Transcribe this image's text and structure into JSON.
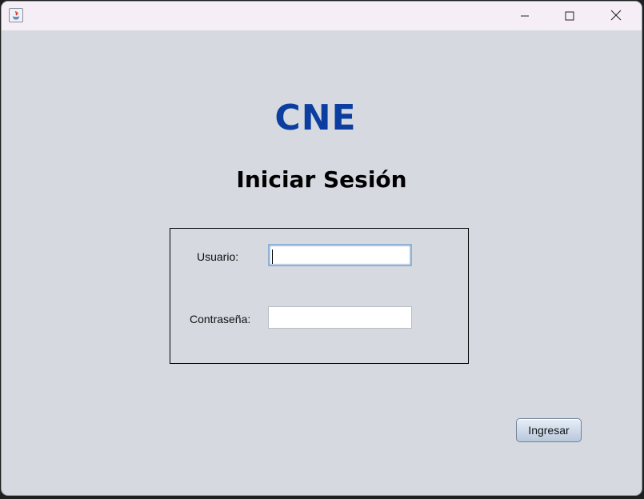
{
  "window": {
    "app_icon": "java-app-icon",
    "controls": {
      "minimize": "minimize-icon",
      "maximize": "maximize-icon",
      "close": "close-icon"
    }
  },
  "brand": {
    "title": "CNE",
    "color": "#0B3EA0"
  },
  "heading": "Iniciar Sesión",
  "form": {
    "username_label": "Usuario:",
    "username_value": "",
    "password_label": "Contraseña:",
    "password_value": ""
  },
  "submit_label": "Ingresar"
}
